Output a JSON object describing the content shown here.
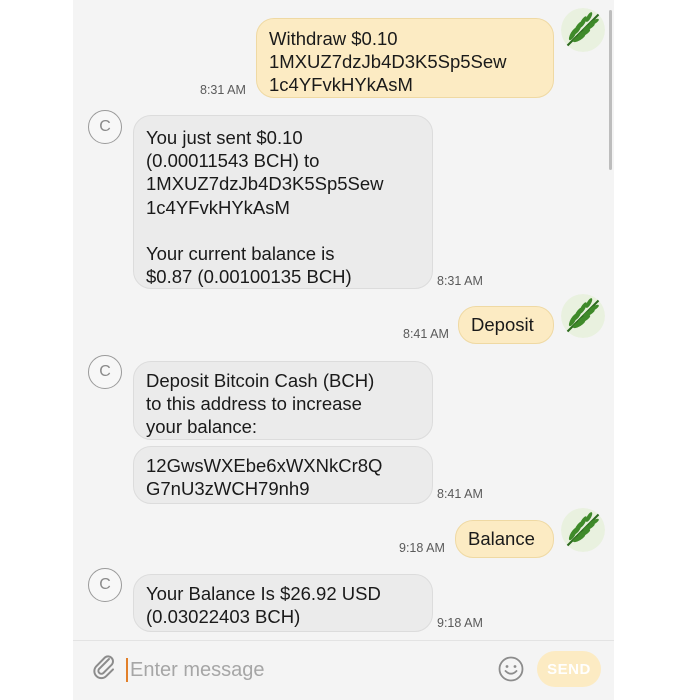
{
  "conversation": {
    "messages": [
      {
        "direction": "outgoing",
        "text": "Withdraw $0.10\n1MXUZ7dzJb4D3K5Sp5Sew\n1c4YFvkHYkAsM",
        "time": "8:31 AM"
      },
      {
        "direction": "incoming",
        "text": "You just sent $0.10\n(0.00011543 BCH) to\n1MXUZ7dzJb4D3K5Sp5Sew\n1c4YFvkHYkAsM\n\nYour current balance is\n$0.87 (0.00100135 BCH)",
        "time": "8:31 AM"
      },
      {
        "direction": "outgoing",
        "text": "Deposit",
        "time": "8:41 AM"
      },
      {
        "direction": "incoming",
        "text": "Deposit Bitcoin Cash (BCH)\nto this address to increase\nyour balance:",
        "time": ""
      },
      {
        "direction": "incoming",
        "text": "12GwsWXEbe6xWXNkCr8Q\nG7nU3zWCH79nh9",
        "time": "8:41 AM"
      },
      {
        "direction": "outgoing",
        "text": "Balance",
        "time": "9:18 AM"
      },
      {
        "direction": "incoming",
        "text": "Your Balance Is $26.92 USD\n(0.03022403 BCH)",
        "time": "9:18 AM"
      }
    ],
    "bot_avatar_letter": "C",
    "user_avatar_icon": "fern-leaf-avatar"
  },
  "composer": {
    "placeholder": "Enter message",
    "send_label": "SEND",
    "attach_icon": "paperclip-icon",
    "emoji_icon": "smiley-icon"
  },
  "colors": {
    "outgoing_bubble": "#fcebc3",
    "incoming_bubble": "#ebebeb",
    "cursor": "#e2802a"
  }
}
